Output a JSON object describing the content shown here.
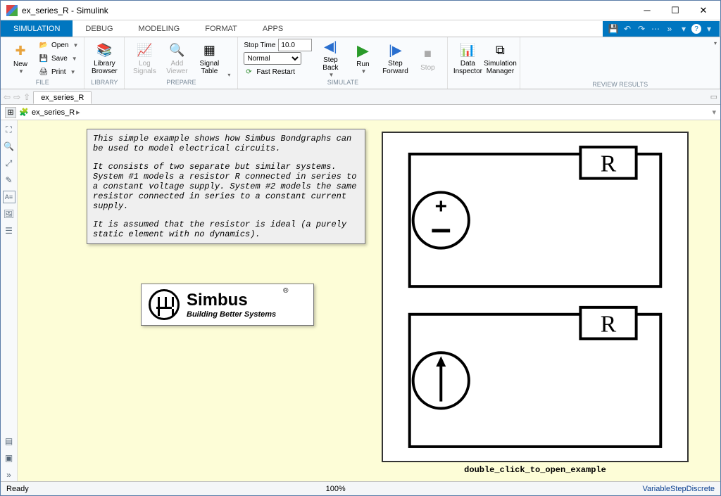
{
  "title": "ex_series_R - Simulink",
  "ribbon": {
    "tabs": [
      "SIMULATION",
      "DEBUG",
      "MODELING",
      "FORMAT",
      "APPS"
    ],
    "groups": {
      "file": "FILE",
      "library": "LIBRARY",
      "prepare": "PREPARE",
      "simulate": "SIMULATE",
      "review": "REVIEW RESULTS"
    },
    "file_items": {
      "new": "New",
      "open": "Open",
      "save": "Save",
      "print": "Print"
    },
    "library_btn": "Library\nBrowser",
    "prepare": {
      "signals": "Log\nSignals",
      "viewer": "Add\nViewer",
      "sigtable": "Signal\nTable"
    },
    "sim": {
      "stop_label": "Stop Time",
      "stop_value": "10.0",
      "mode": "Normal",
      "fast_restart": "Fast Restart",
      "back": "Step\nBack",
      "run": "Run",
      "fwd": "Step\nForward",
      "stop": "Stop"
    },
    "review": {
      "di": "Data\nInspector",
      "sm": "Simulation\nManager"
    }
  },
  "filetab": "ex_series_R",
  "breadcrumb": "ex_series_R",
  "annotation": {
    "p1": "This simple example shows how Simbus Bondgraphs can be used to model electrical circuits.",
    "p2": "It consists of two separate but similar systems.  System #1 models a resistor R connected in series to a constant voltage supply.  System #2 models the same resistor connected in series to a constant current supply.",
    "p3": "It is assumed that the resistor is ideal (a purely static element with no dynamics)."
  },
  "logo": {
    "name": "Simbus",
    "tagline": "Building Better Systems",
    "reg": "®"
  },
  "circuit": {
    "r_label": "R"
  },
  "caption": "double_click_to_open_example",
  "status": {
    "ready": "Ready",
    "zoom": "100%",
    "solver": "VariableStepDiscrete"
  }
}
